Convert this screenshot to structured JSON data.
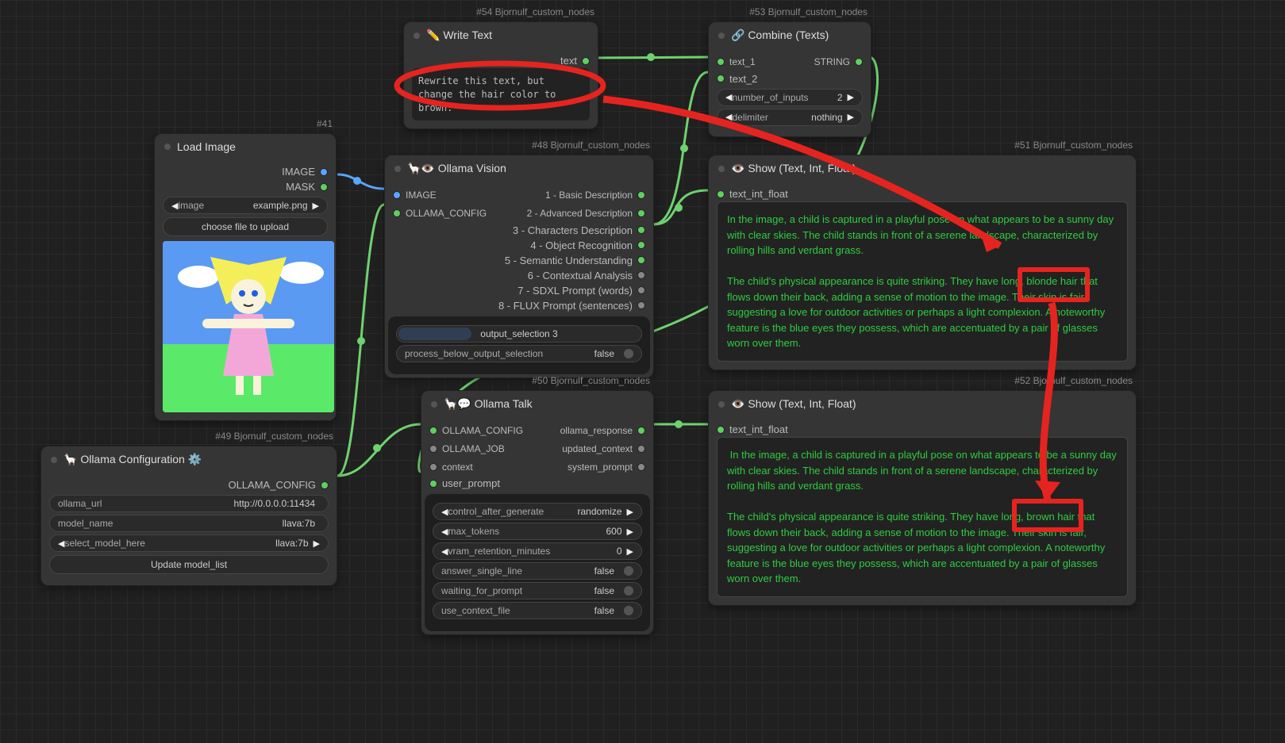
{
  "nodes": {
    "writeText": {
      "tag": "#54 Bjornulf_custom_nodes",
      "title": "✏️ Write Text",
      "outPort": "text",
      "content": "Rewrite this text, but change the hair color to brown:"
    },
    "combine": {
      "tag": "#53 Bjornulf_custom_nodes",
      "title": "🔗 Combine (Texts)",
      "in1": "text_1",
      "in2": "text_2",
      "outType": "STRING",
      "w1label": "number_of_inputs",
      "w1val": "2",
      "w2label": "delimiter",
      "w2val": "nothing"
    },
    "loadImage": {
      "tag": "#41",
      "title": "Load Image",
      "out1": "IMAGE",
      "out2": "MASK",
      "imgLabel": "image",
      "imgVal": "example.png",
      "uploadBtn": "choose file to upload"
    },
    "vision": {
      "tag": "#48 Bjornulf_custom_nodes",
      "title": "🦙👁️ Ollama Vision",
      "in1": "IMAGE",
      "in2": "OLLAMA_CONFIG",
      "out1": "1 - Basic Description",
      "out2": "2 - Advanced Description",
      "out3": "3 - Characters Description",
      "out4": "4 - Object Recognition",
      "out5": "5 - Semantic Understanding",
      "out6": "6 - Contextual Analysis",
      "out7": "7 - SDXL Prompt (words)",
      "out8": "8 - FLUX Prompt (sentences)",
      "selLabel": "output_selection  3",
      "procLabel": "process_below_output_selection",
      "procVal": "false"
    },
    "config": {
      "tag": "#49 Bjornulf_custom_nodes",
      "title": "🦙 Ollama Configuration ⚙️",
      "out": "OLLAMA_CONFIG",
      "w1l": "ollama_url",
      "w1v": "http://0.0.0.0:11434",
      "w2l": "model_name",
      "w2v": "llava:7b",
      "w3l": "select_model_here",
      "w3v": "llava:7b",
      "btn": "Update model_list"
    },
    "talk": {
      "tag": "#50 Bjornulf_custom_nodes",
      "title": "🦙💬 Ollama Talk",
      "in1": "OLLAMA_CONFIG",
      "in2": "OLLAMA_JOB",
      "in3": "context",
      "in4": "user_prompt",
      "out1": "ollama_response",
      "out2": "updated_context",
      "out3": "system_prompt",
      "w1l": "control_after_generate",
      "w1v": "randomize",
      "w2l": "max_tokens",
      "w2v": "600",
      "w3l": "vram_retention_minutes",
      "w3v": "0",
      "w4l": "answer_single_line",
      "w4v": "false",
      "w5l": "waiting_for_prompt",
      "w5v": "false",
      "w6l": "use_context_file",
      "w6v": "false"
    },
    "show1": {
      "tag": "#51 Bjornulf_custom_nodes",
      "title": "👁️ Show (Text, Int, Float)",
      "in": "text_int_float",
      "text": "In the image, a child is captured in a playful pose on what appears to be a sunny day with clear skies. The child stands in front of a serene landscape, characterized by rolling hills and verdant grass.\n\nThe child's physical appearance is quite striking. They have long, blonde hair that flows down their back, adding a sense of motion to the image. Their skin is fair, suggesting a love for outdoor activities or perhaps a light complexion. A noteworthy feature is the blue eyes they possess, which are accentuated by a pair of glasses worn over them."
    },
    "show2": {
      "tag": "#52 Bjornulf_custom_nodes",
      "title": "👁️ Show (Text, Int, Float)",
      "in": "text_int_float",
      "text": " In the image, a child is captured in a playful pose on what appears to be a sunny day with clear skies. The child stands in front of a serene landscape, characterized by rolling hills and verdant grass.\n\nThe child's physical appearance is quite striking. They have long, brown hair that flows down their back, adding a sense of motion to the image. Their skin is fair, suggesting a love for outdoor activities or perhaps a light complexion. A noteworthy feature is the blue eyes they possess, which are accentuated by a pair of glasses worn over them."
    }
  }
}
